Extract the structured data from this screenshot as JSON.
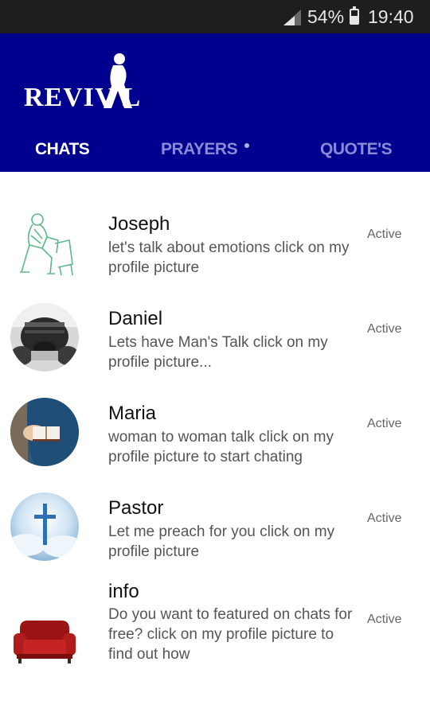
{
  "status_bar": {
    "battery": "54%",
    "battery_level": 0.54,
    "time": "19:40"
  },
  "app": {
    "logo_text": "REVIV L",
    "colors": {
      "header": "#00008e",
      "active_tab": "#ffffff",
      "inactive_tab": "#8a8ad8"
    }
  },
  "tabs": [
    {
      "label": "CHATS",
      "active": true
    },
    {
      "label": "PRAYERS",
      "active": false,
      "has_dot": true
    },
    {
      "label": "QUOTE'S",
      "active": false
    }
  ],
  "chats": [
    {
      "name": "Joseph",
      "message": "let's talk about emotions click on my profile picture",
      "status": "Active",
      "avatar": "sketch-man-sitting-icon"
    },
    {
      "name": "Daniel",
      "message": "Lets have Man's Talk click on my profile picture...",
      "status": "Active",
      "avatar": "man-praying-photo"
    },
    {
      "name": "Maria",
      "message": "woman to woman talk click on my profile picture to start chating",
      "status": "Active",
      "avatar": "woman-reading-bible-photo"
    },
    {
      "name": "Pastor",
      "message": "Let me preach for you click on my profile picture",
      "status": "Active",
      "avatar": "cross-in-clouds-photo"
    },
    {
      "name": "info",
      "message": "Do you want to featured on chats for free? click on my profile picture to find out how",
      "status": "Active",
      "avatar": "red-sofa-icon"
    }
  ]
}
